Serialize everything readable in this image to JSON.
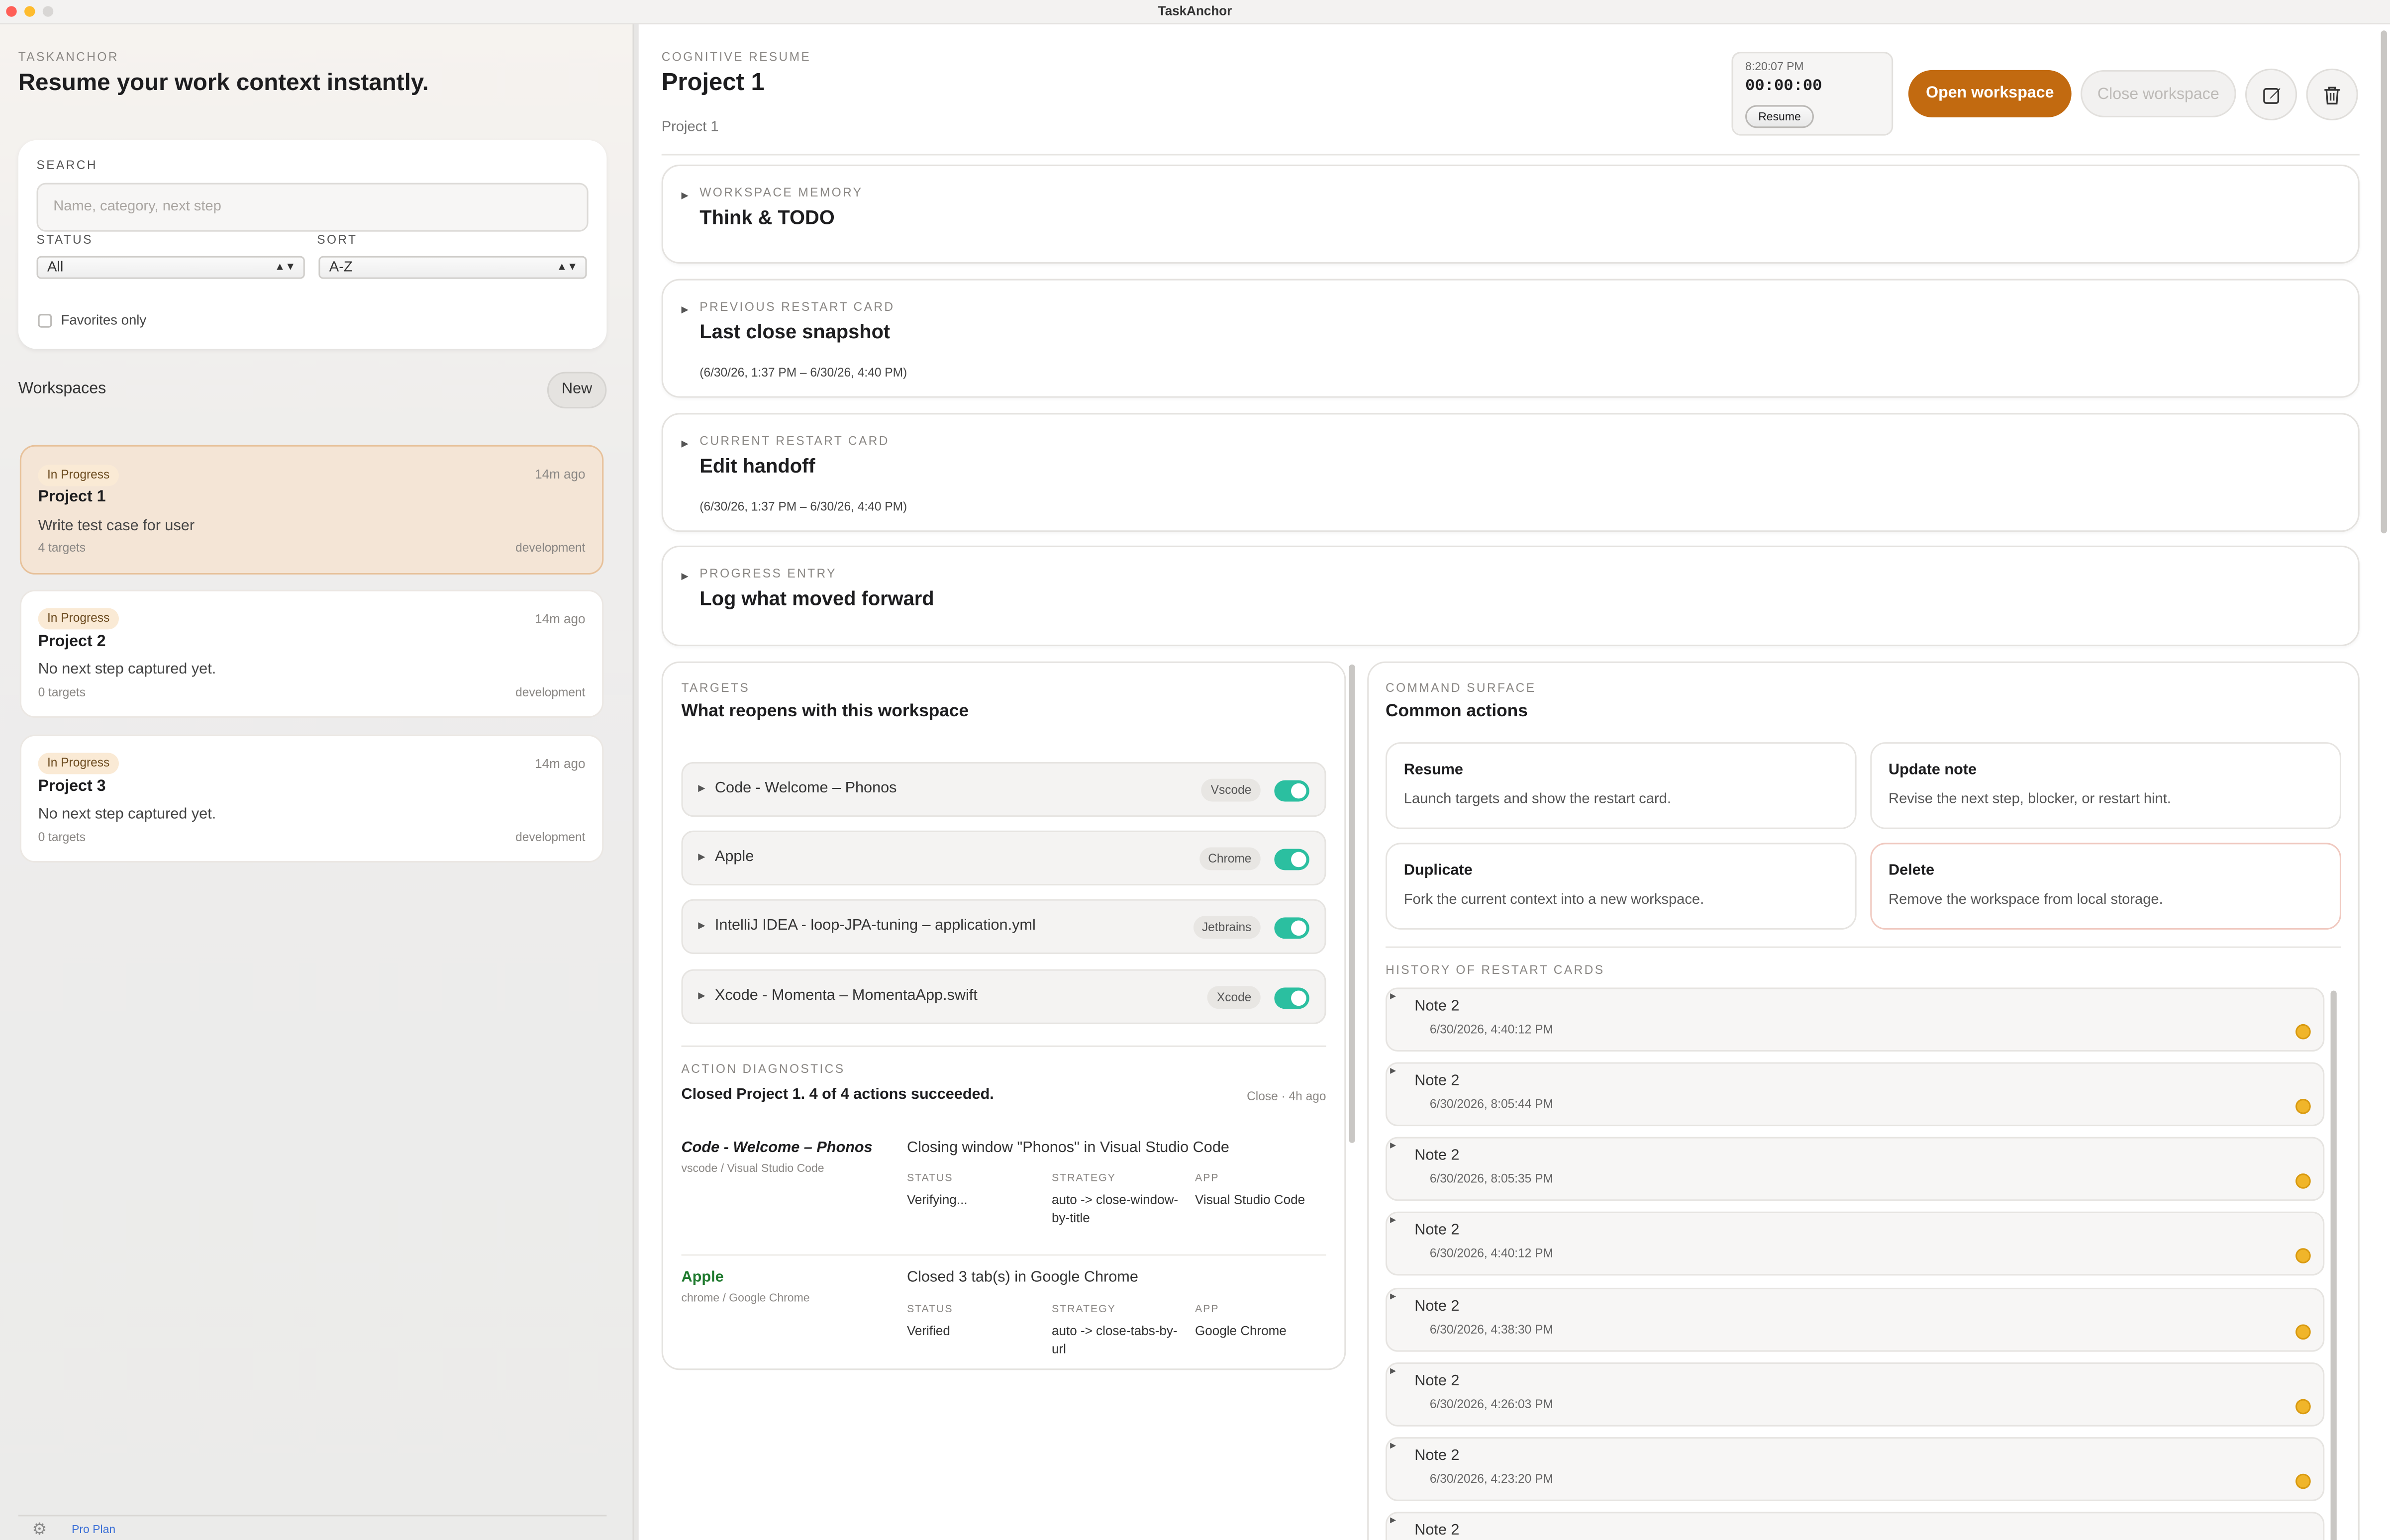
{
  "window": {
    "title": "TaskAnchor"
  },
  "sidebar": {
    "eyebrow": "TASKANCHOR",
    "headline": "Resume your work context instantly.",
    "search_label": "SEARCH",
    "search_placeholder": "Name, category, next step",
    "status_label": "STATUS",
    "status_value": "All",
    "sort_label": "SORT",
    "sort_value": "A-Z",
    "favorites_label": "Favorites only",
    "workspaces_label": "Workspaces",
    "new_button": "New",
    "workspaces": [
      {
        "status": "In Progress",
        "time": "14m ago",
        "name": "Project 1",
        "next_step": "Write test case for user",
        "targets": "4 targets",
        "category": "development"
      },
      {
        "status": "In Progress",
        "time": "14m ago",
        "name": "Project 2",
        "next_step": "No next step captured yet.",
        "targets": "0 targets",
        "category": "development"
      },
      {
        "status": "In Progress",
        "time": "14m ago",
        "name": "Project 3",
        "next_step": "No next step captured yet.",
        "targets": "0 targets",
        "category": "development"
      }
    ],
    "footer_plan": "Pro Plan"
  },
  "header": {
    "eyebrow": "COGNITIVE RESUME",
    "title": "Project 1",
    "subtitle": "Project 1",
    "timer_time": "8:20:07 PM",
    "timer_value": "00:00:00",
    "timer_button": "Resume",
    "open_button": "Open workspace",
    "close_button": "Close workspace"
  },
  "sections": [
    {
      "eyebrow": "WORKSPACE MEMORY",
      "title": "Think & TODO",
      "sub": ""
    },
    {
      "eyebrow": "PREVIOUS RESTART CARD",
      "title": "Last close snapshot",
      "sub": "(6/30/26, 1:37 PM – 6/30/26, 4:40 PM)"
    },
    {
      "eyebrow": "CURRENT RESTART CARD",
      "title": "Edit handoff",
      "sub": "(6/30/26, 1:37 PM – 6/30/26, 4:40 PM)"
    },
    {
      "eyebrow": "PROGRESS ENTRY",
      "title": "Log what moved forward",
      "sub": ""
    }
  ],
  "targets": {
    "eyebrow": "TARGETS",
    "title": "What reopens with this workspace",
    "items": [
      {
        "label": "Code - Welcome – Phonos",
        "chip": "Vscode",
        "enabled": true
      },
      {
        "label": "Apple",
        "chip": "Chrome",
        "enabled": true
      },
      {
        "label": "IntelliJ IDEA - loop-JPA-tuning – application.yml",
        "chip": "Jetbrains",
        "enabled": true
      },
      {
        "label": "Xcode - Momenta – MomentaApp.swift",
        "chip": "Xcode",
        "enabled": true
      }
    ]
  },
  "diagnostics": {
    "eyebrow": "ACTION DIAGNOSTICS",
    "summary": "Closed Project 1. 4 of 4 actions succeeded.",
    "meta": "Close · 4h ago",
    "status_label": "STATUS",
    "strategy_label": "STRATEGY",
    "app_label": "APP",
    "entries": [
      {
        "name": "Code - Welcome – Phonos",
        "source": "vscode / Visual Studio Code",
        "message": "Closing window \"Phonos\" in Visual Studio Code",
        "status": "Verifying...",
        "strategy": "auto -> close-window-by-title",
        "app": "Visual Studio Code"
      },
      {
        "name": "Apple",
        "source": "chrome / Google Chrome",
        "message": "Closed 3 tab(s) in Google Chrome",
        "status": "Verified",
        "strategy": "auto -> close-tabs-by-url",
        "app": "Google Chrome"
      }
    ]
  },
  "commands": {
    "eyebrow": "COMMAND SURFACE",
    "title": "Common actions",
    "actions": [
      {
        "title": "Resume",
        "desc": "Launch targets and show the restart card."
      },
      {
        "title": "Update note",
        "desc": "Revise the next step, blocker, or restart hint."
      },
      {
        "title": "Duplicate",
        "desc": "Fork the current context into a new workspace."
      },
      {
        "title": "Delete",
        "desc": "Remove the workspace from local storage."
      }
    ]
  },
  "history": {
    "eyebrow": "HISTORY OF RESTART CARDS",
    "items": [
      {
        "note": "Note 2",
        "time": "6/30/2026, 4:40:12 PM"
      },
      {
        "note": "Note 2",
        "time": "6/30/2026, 8:05:44 PM"
      },
      {
        "note": "Note 2",
        "time": "6/30/2026, 8:05:35 PM"
      },
      {
        "note": "Note 2",
        "time": "6/30/2026, 4:40:12 PM"
      },
      {
        "note": "Note 2",
        "time": "6/30/2026, 4:38:30 PM"
      },
      {
        "note": "Note 2",
        "time": "6/30/2026, 4:26:03 PM"
      },
      {
        "note": "Note 2",
        "time": "6/30/2026, 4:23:20 PM"
      },
      {
        "note": "Note 2",
        "time": ""
      }
    ]
  },
  "colors": {
    "accent": "#c26a10",
    "toggle_on": "#2bbfa0",
    "history_dot": "#f0b52a",
    "selected_card": "#f5e7da"
  },
  "icons": [
    "edit-icon",
    "trash-icon",
    "gear-icon",
    "disclosure-triangle-icon"
  ]
}
